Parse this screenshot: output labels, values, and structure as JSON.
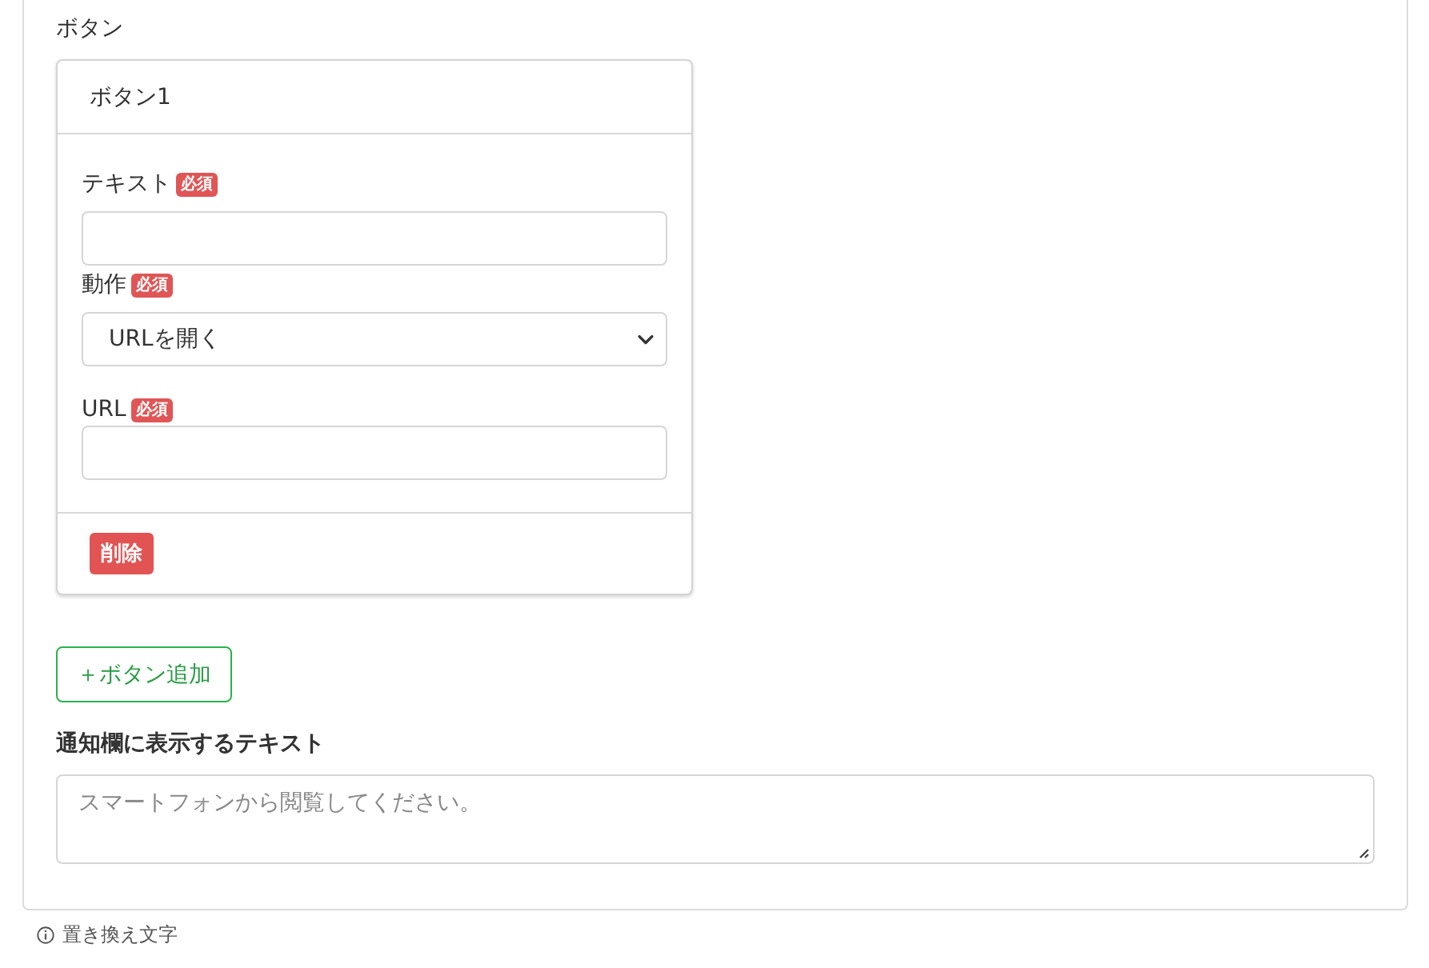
{
  "section_label": "ボタン",
  "buttons": [
    {
      "title": "ボタン1",
      "fields": [
        {
          "kind": "text",
          "label": "テキスト",
          "badge": "必須"
        },
        {
          "kind": "select",
          "label": "動作",
          "badge": "必須",
          "value": "URLを開く"
        },
        {
          "kind": "text",
          "label": "URL",
          "badge": "必須"
        }
      ],
      "delete_button": "削除"
    }
  ],
  "add_button": "＋ボタン追加",
  "notification": {
    "label": "通知欄に表示するテキスト",
    "placeholder": "スマートフォンから閲覧してください。"
  },
  "footer_note": "置き換え文字"
}
